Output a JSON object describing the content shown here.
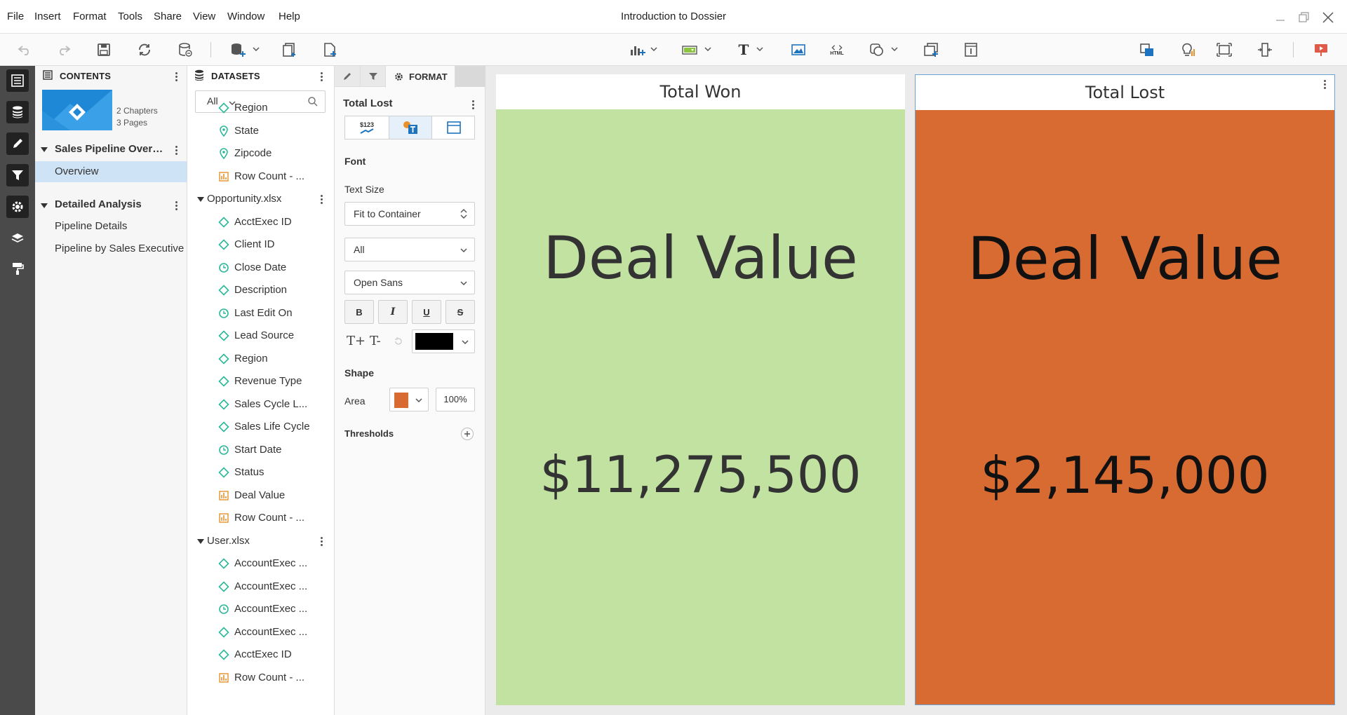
{
  "app": {
    "title": "Introduction to Dossier",
    "menu": [
      "File",
      "Insert",
      "Format",
      "Tools",
      "Share",
      "View",
      "Window",
      "Help"
    ]
  },
  "toolbar": {
    "left_icons": [
      "undo-icon",
      "redo-icon",
      "save-icon",
      "refresh-icon",
      "data-source-icon",
      "add-dataset-icon",
      "add-chapter-icon",
      "add-page-icon"
    ],
    "center_icons": [
      "visualization-icon",
      "filter-icon",
      "text-icon",
      "image-icon",
      "html-container-icon",
      "shape-icon",
      "panel-stack-icon",
      "information-icon"
    ],
    "center_labels": {
      "text": "T",
      "html": "HTML"
    },
    "right_icons": [
      "bring-forward-icon",
      "insights-icon",
      "fit-to-page-icon",
      "responsive-icon",
      "present-icon"
    ]
  },
  "contents": {
    "header": "CONTENTS",
    "summary": {
      "chapters": "2 Chapters",
      "pages": "3 Pages"
    },
    "chapters": [
      {
        "title": "Sales Pipeline Overview",
        "pages": [
          "Overview"
        ]
      },
      {
        "title": "Detailed Analysis",
        "pages": [
          "Pipeline Details",
          "Pipeline by Sales Executive"
        ]
      }
    ],
    "selected_page": "Overview"
  },
  "datasets": {
    "header": "DATASETS",
    "filter_value": "All",
    "items_before": [
      {
        "label": "Region",
        "kind": "attribute"
      },
      {
        "label": "State",
        "kind": "geo"
      },
      {
        "label": "Zipcode",
        "kind": "geo"
      },
      {
        "label": "Row Count - ...",
        "kind": "metric"
      }
    ],
    "files": [
      {
        "name": "Opportunity.xlsx",
        "items": [
          {
            "label": "AcctExec ID",
            "kind": "attribute"
          },
          {
            "label": "Client ID",
            "kind": "attribute"
          },
          {
            "label": "Close Date",
            "kind": "date"
          },
          {
            "label": "Description",
            "kind": "attribute"
          },
          {
            "label": "Last Edit On",
            "kind": "date"
          },
          {
            "label": "Lead Source",
            "kind": "attribute"
          },
          {
            "label": "Region",
            "kind": "attribute"
          },
          {
            "label": "Revenue Type",
            "kind": "attribute"
          },
          {
            "label": "Sales Cycle L...",
            "kind": "attribute"
          },
          {
            "label": "Sales Life Cycle",
            "kind": "attribute"
          },
          {
            "label": "Start Date",
            "kind": "date"
          },
          {
            "label": "Status",
            "kind": "attribute"
          },
          {
            "label": "Deal Value",
            "kind": "metric"
          },
          {
            "label": "Row Count - ...",
            "kind": "metric"
          }
        ]
      },
      {
        "name": "User.xlsx",
        "items": [
          {
            "label": "AccountExec ...",
            "kind": "attribute"
          },
          {
            "label": "AccountExec ...",
            "kind": "attribute"
          },
          {
            "label": "AccountExec ...",
            "kind": "date"
          },
          {
            "label": "AccountExec ...",
            "kind": "attribute"
          },
          {
            "label": "AcctExec ID",
            "kind": "attribute"
          },
          {
            "label": "Row Count - ...",
            "kind": "metric"
          }
        ]
      }
    ]
  },
  "format": {
    "tab_label": "FORMAT",
    "target": "Total Lost",
    "font_section": "Font",
    "text_size_label": "Text Size",
    "text_size_value": "Fit to Container",
    "scope_value": "All",
    "font_family_value": "Open Sans",
    "style_buttons": [
      "B",
      "I",
      "U",
      "S"
    ],
    "grow_label": "T+",
    "shrink_label": "T-",
    "font_color": "#000000",
    "shape_section": "Shape",
    "area_label": "Area",
    "area_color": "#d86b32",
    "opacity": "100%",
    "thresholds_label": "Thresholds",
    "sub_tab_icon_label": "$123"
  },
  "canvas": {
    "cards": [
      {
        "title": "Total Won",
        "metric": "Deal Value",
        "value": "$11,275,500",
        "bg": "#c2e2a2",
        "text_color": "#333333"
      },
      {
        "title": "Total Lost",
        "metric": "Deal Value",
        "value": "$2,145,000",
        "bg": "#d86b32",
        "text_color": "#111111"
      }
    ]
  },
  "colors": {
    "strip_bg": "#4a4a4a",
    "selected_page_bg": "#cfe3f6",
    "teal_icon": "#2bb79a",
    "metric_icon": "#e8912c",
    "selection_border": "#6aa3d8"
  }
}
